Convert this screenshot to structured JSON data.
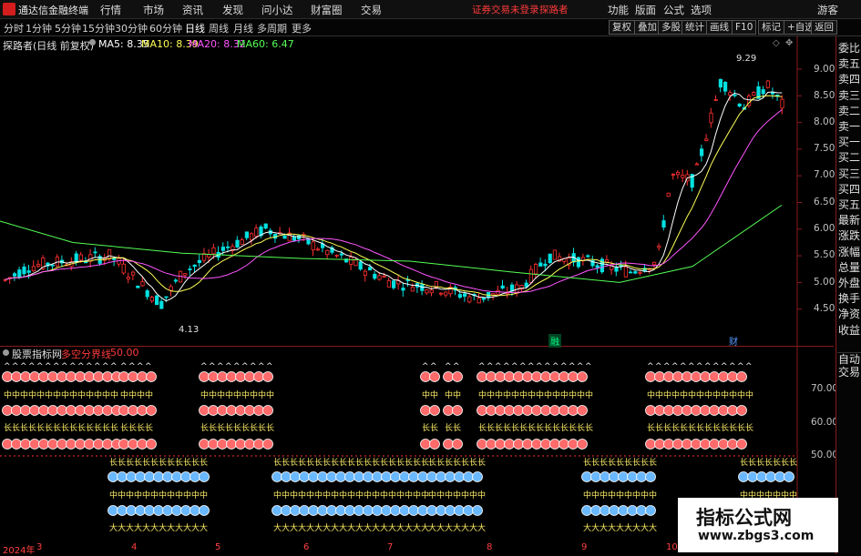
{
  "app": {
    "title": "通达信金融终端",
    "login_status": "证券交易未登录",
    "user": "探路者",
    "guest": "游客"
  },
  "menu": {
    "items": [
      "行情",
      "市场",
      "资讯",
      "发现",
      "问小达",
      "财富圈",
      "交易"
    ],
    "right_items": [
      "功能",
      "版面",
      "公式",
      "选项"
    ]
  },
  "periods": {
    "items": [
      "分时",
      "1分钟",
      "5分钟",
      "15分钟",
      "30分钟",
      "60分钟",
      "日线",
      "周线",
      "月线",
      "多周期",
      "更多"
    ],
    "selected": "日线"
  },
  "toolbar_right": [
    "复权",
    "叠加",
    "多股",
    "统计",
    "画线",
    "F10",
    "标记",
    "+自选",
    "返回"
  ],
  "main_chart": {
    "stock": "探路者(日线 前复权)",
    "ma": [
      {
        "label": "MA5: 8.35",
        "color": "#ffffff"
      },
      {
        "label": "MA10: 8.39",
        "color": "#ffff55"
      },
      {
        "label": "MA20: 8.32",
        "color": "#ff55ff"
      },
      {
        "label": "MA60: 6.47",
        "color": "#55ff55"
      }
    ],
    "yaxis": [
      "9.00",
      "8.50",
      "8.00",
      "7.50",
      "7.00",
      "6.50",
      "6.00",
      "5.50",
      "5.00",
      "4.50"
    ],
    "high_mark": "9.29",
    "low_mark": "4.13",
    "markers": [
      {
        "text": "融"
      },
      {
        "text": "财"
      }
    ]
  },
  "sub_chart": {
    "title": "股票指标网",
    "line_name": "多空分界线",
    "line_value": "50.00",
    "yaxis": [
      "70.00",
      "60.00",
      "50.00"
    ],
    "rows_top": [
      "^",
      "●",
      "中",
      "●",
      "长",
      "●"
    ],
    "rows_bottom": [
      "长",
      "●",
      "中",
      "●",
      "大"
    ]
  },
  "right_panel": {
    "items": [
      "委比",
      "卖五",
      "卖四",
      "卖三",
      "卖二",
      "卖一",
      "买一",
      "买二",
      "买三",
      "买四",
      "买五",
      "最新",
      "涨跌",
      "涨幅",
      "总量",
      "外盘",
      "换手",
      "净资",
      "收益"
    ],
    "lower": [
      "自动",
      "交易"
    ]
  },
  "dates": {
    "year": "2024年",
    "months": [
      "3",
      "4",
      "5",
      "6",
      "7",
      "8",
      "9",
      "10"
    ]
  },
  "watermark": {
    "line1": "指标公式网",
    "line2": "www.zbgs3.com"
  },
  "colors": {
    "up": "#ff3030",
    "down": "#00e0e0",
    "accent": "#ff3a3a"
  }
}
